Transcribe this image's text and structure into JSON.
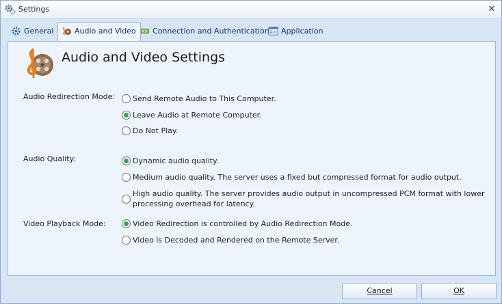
{
  "window": {
    "title": "Settings",
    "close_glyph": "✕"
  },
  "tabs": [
    {
      "label": "General",
      "icon": "gear-icon",
      "active": false
    },
    {
      "label": "Audio and Video",
      "icon": "audio-video-icon",
      "active": true
    },
    {
      "label": "Connection and Authentication",
      "icon": "connection-icon",
      "active": false
    },
    {
      "label": "Application",
      "icon": "application-icon",
      "active": false
    }
  ],
  "panel": {
    "title": "Audio and Video Settings",
    "groups": [
      {
        "label": "Audio Redirection Mode:",
        "options": [
          {
            "label": "Send Remote Audio to This Computer.",
            "selected": false
          },
          {
            "label": "Leave Audio at Remote Computer.",
            "selected": true
          },
          {
            "label": "Do Not Play.",
            "selected": false
          }
        ]
      },
      {
        "label": "Audio Quality:",
        "options": [
          {
            "label": "Dynamic audio quality.",
            "selected": true
          },
          {
            "label": "Medium audio quality. The server uses a fixed but compressed format for audio output.",
            "selected": false
          },
          {
            "label": "High audio quality. The server provides audio output in uncompressed PCM format with lower processing overhead for latency.",
            "selected": false
          }
        ]
      },
      {
        "label": "Video Playback Mode:",
        "options": [
          {
            "label": "Video Redirection is controlled by Audio Redirection Mode.",
            "selected": true
          },
          {
            "label": "Video is Decoded and Rendered on the Remote Server.",
            "selected": false
          }
        ]
      }
    ]
  },
  "buttons": {
    "cancel": "Cancel",
    "ok": "OK"
  },
  "colors": {
    "accent": "#2fa84a",
    "panel_bg": "#eef4fc",
    "frame_bg": "#d7e5f5",
    "tab_text": "#15306b"
  }
}
